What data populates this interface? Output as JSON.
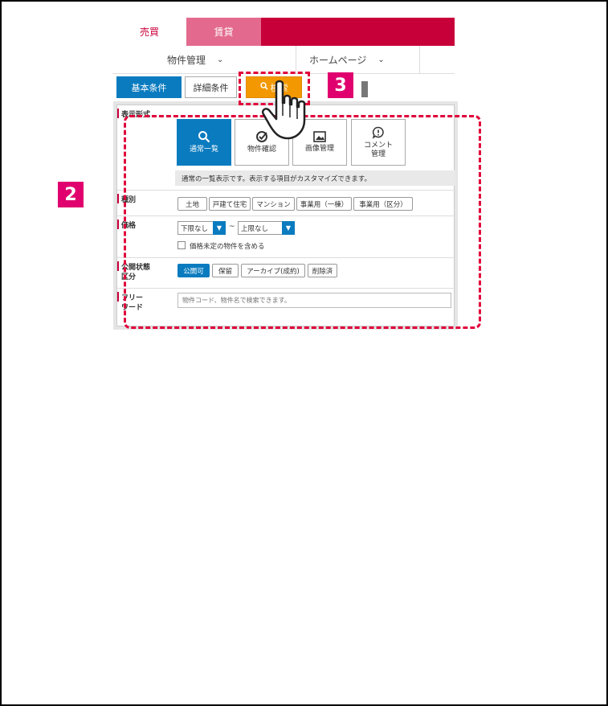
{
  "top_tabs": {
    "sell": "売買",
    "rent": "賃貸"
  },
  "nav": {
    "property_mgmt": "物件管理",
    "homepage": "ホームページ"
  },
  "conditions": {
    "basic": "基本条件",
    "detail": "詳細条件",
    "search": "検索"
  },
  "display_format": {
    "label": "表示形式",
    "modes": [
      {
        "label": "通常一覧",
        "icon": "search-icon",
        "active": true
      },
      {
        "label": "物件確認",
        "icon": "check-circle-icon",
        "active": false
      },
      {
        "label": "画像管理",
        "icon": "image-icon",
        "active": false
      },
      {
        "label_line1": "コメント",
        "label_line2": "管理",
        "icon": "comment-alert-icon",
        "active": false
      }
    ],
    "description": "通常の一覧表示です。表示する項目がカスタマイズできます。"
  },
  "type": {
    "label": "種別",
    "options": [
      "土地",
      "戸建て住宅",
      "マンション",
      "事業用（一棟）",
      "事業用（区分）"
    ]
  },
  "price": {
    "label": "価格",
    "lower": "下限なし",
    "upper": "上限なし",
    "tilde": "~",
    "include_undecided": "価格未定の物件を含める"
  },
  "status": {
    "label_line1": "公開状態",
    "label_line2": "区分",
    "options": [
      "公開可",
      "保留",
      "アーカイブ(成約)",
      "削除済"
    ],
    "active_index": 0
  },
  "freeword": {
    "label_line1": "フリー",
    "label_line2": "ワード",
    "placeholder": "物件コード、物件名で検索できます。"
  },
  "annotations": {
    "badge_2": "2",
    "badge_3": "3"
  },
  "colors": {
    "brand": "#c8003a",
    "accent_blue": "#0a7bbf",
    "search_orange": "#f39800",
    "annotation_red": "#e0003a",
    "badge_pink": "#e0006e"
  }
}
